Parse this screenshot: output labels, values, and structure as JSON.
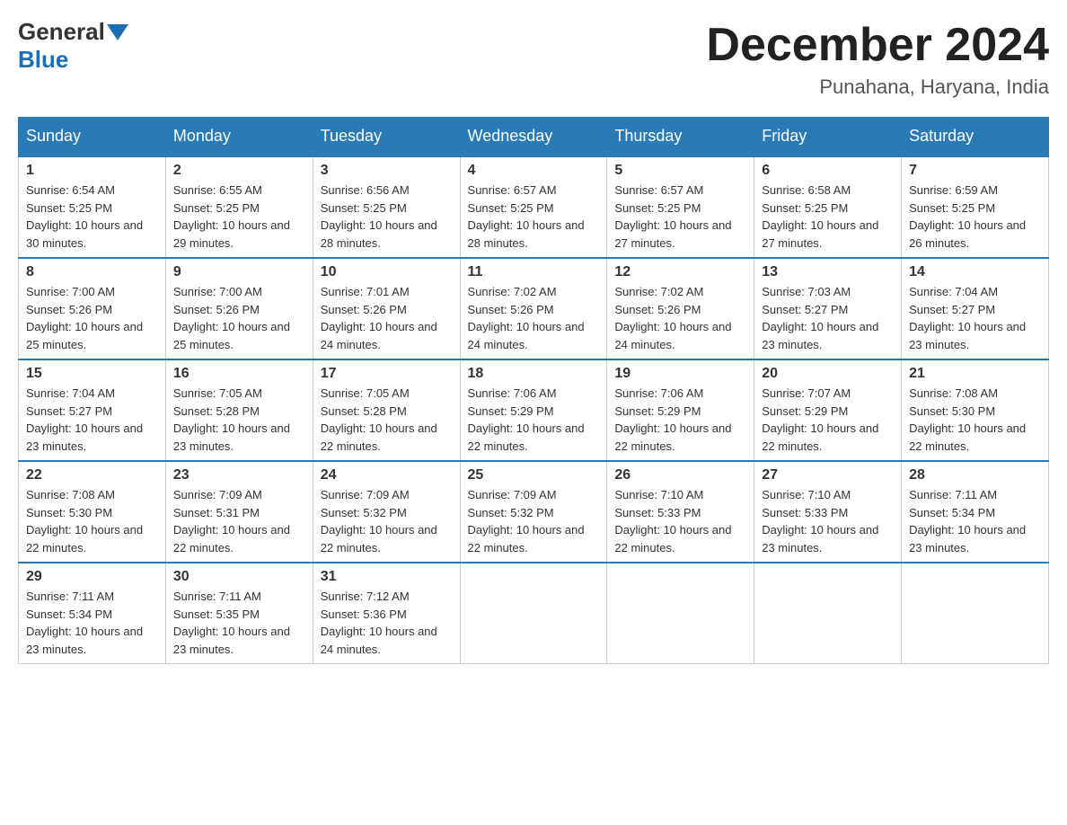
{
  "header": {
    "logo_general": "General",
    "logo_blue": "Blue",
    "month_title": "December 2024",
    "location": "Punahana, Haryana, India"
  },
  "days_of_week": [
    "Sunday",
    "Monday",
    "Tuesday",
    "Wednesday",
    "Thursday",
    "Friday",
    "Saturday"
  ],
  "weeks": [
    [
      {
        "day": "1",
        "sunrise": "6:54 AM",
        "sunset": "5:25 PM",
        "daylight": "10 hours and 30 minutes."
      },
      {
        "day": "2",
        "sunrise": "6:55 AM",
        "sunset": "5:25 PM",
        "daylight": "10 hours and 29 minutes."
      },
      {
        "day": "3",
        "sunrise": "6:56 AM",
        "sunset": "5:25 PM",
        "daylight": "10 hours and 28 minutes."
      },
      {
        "day": "4",
        "sunrise": "6:57 AM",
        "sunset": "5:25 PM",
        "daylight": "10 hours and 28 minutes."
      },
      {
        "day": "5",
        "sunrise": "6:57 AM",
        "sunset": "5:25 PM",
        "daylight": "10 hours and 27 minutes."
      },
      {
        "day": "6",
        "sunrise": "6:58 AM",
        "sunset": "5:25 PM",
        "daylight": "10 hours and 27 minutes."
      },
      {
        "day": "7",
        "sunrise": "6:59 AM",
        "sunset": "5:25 PM",
        "daylight": "10 hours and 26 minutes."
      }
    ],
    [
      {
        "day": "8",
        "sunrise": "7:00 AM",
        "sunset": "5:26 PM",
        "daylight": "10 hours and 25 minutes."
      },
      {
        "day": "9",
        "sunrise": "7:00 AM",
        "sunset": "5:26 PM",
        "daylight": "10 hours and 25 minutes."
      },
      {
        "day": "10",
        "sunrise": "7:01 AM",
        "sunset": "5:26 PM",
        "daylight": "10 hours and 24 minutes."
      },
      {
        "day": "11",
        "sunrise": "7:02 AM",
        "sunset": "5:26 PM",
        "daylight": "10 hours and 24 minutes."
      },
      {
        "day": "12",
        "sunrise": "7:02 AM",
        "sunset": "5:26 PM",
        "daylight": "10 hours and 24 minutes."
      },
      {
        "day": "13",
        "sunrise": "7:03 AM",
        "sunset": "5:27 PM",
        "daylight": "10 hours and 23 minutes."
      },
      {
        "day": "14",
        "sunrise": "7:04 AM",
        "sunset": "5:27 PM",
        "daylight": "10 hours and 23 minutes."
      }
    ],
    [
      {
        "day": "15",
        "sunrise": "7:04 AM",
        "sunset": "5:27 PM",
        "daylight": "10 hours and 23 minutes."
      },
      {
        "day": "16",
        "sunrise": "7:05 AM",
        "sunset": "5:28 PM",
        "daylight": "10 hours and 23 minutes."
      },
      {
        "day": "17",
        "sunrise": "7:05 AM",
        "sunset": "5:28 PM",
        "daylight": "10 hours and 22 minutes."
      },
      {
        "day": "18",
        "sunrise": "7:06 AM",
        "sunset": "5:29 PM",
        "daylight": "10 hours and 22 minutes."
      },
      {
        "day": "19",
        "sunrise": "7:06 AM",
        "sunset": "5:29 PM",
        "daylight": "10 hours and 22 minutes."
      },
      {
        "day": "20",
        "sunrise": "7:07 AM",
        "sunset": "5:29 PM",
        "daylight": "10 hours and 22 minutes."
      },
      {
        "day": "21",
        "sunrise": "7:08 AM",
        "sunset": "5:30 PM",
        "daylight": "10 hours and 22 minutes."
      }
    ],
    [
      {
        "day": "22",
        "sunrise": "7:08 AM",
        "sunset": "5:30 PM",
        "daylight": "10 hours and 22 minutes."
      },
      {
        "day": "23",
        "sunrise": "7:09 AM",
        "sunset": "5:31 PM",
        "daylight": "10 hours and 22 minutes."
      },
      {
        "day": "24",
        "sunrise": "7:09 AM",
        "sunset": "5:32 PM",
        "daylight": "10 hours and 22 minutes."
      },
      {
        "day": "25",
        "sunrise": "7:09 AM",
        "sunset": "5:32 PM",
        "daylight": "10 hours and 22 minutes."
      },
      {
        "day": "26",
        "sunrise": "7:10 AM",
        "sunset": "5:33 PM",
        "daylight": "10 hours and 22 minutes."
      },
      {
        "day": "27",
        "sunrise": "7:10 AM",
        "sunset": "5:33 PM",
        "daylight": "10 hours and 23 minutes."
      },
      {
        "day": "28",
        "sunrise": "7:11 AM",
        "sunset": "5:34 PM",
        "daylight": "10 hours and 23 minutes."
      }
    ],
    [
      {
        "day": "29",
        "sunrise": "7:11 AM",
        "sunset": "5:34 PM",
        "daylight": "10 hours and 23 minutes."
      },
      {
        "day": "30",
        "sunrise": "7:11 AM",
        "sunset": "5:35 PM",
        "daylight": "10 hours and 23 minutes."
      },
      {
        "day": "31",
        "sunrise": "7:12 AM",
        "sunset": "5:36 PM",
        "daylight": "10 hours and 24 minutes."
      },
      null,
      null,
      null,
      null
    ]
  ],
  "labels": {
    "sunrise": "Sunrise: ",
    "sunset": "Sunset: ",
    "daylight": "Daylight: "
  }
}
